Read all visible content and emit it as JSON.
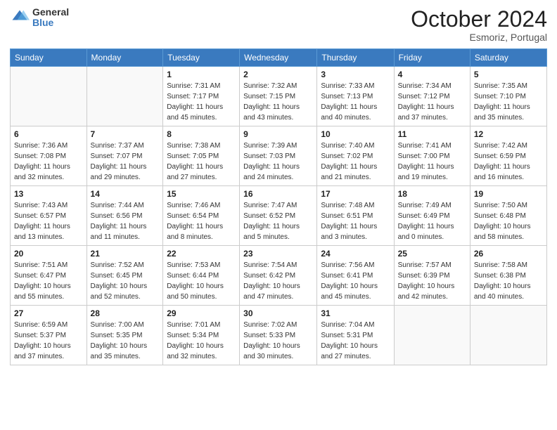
{
  "logo": {
    "general": "General",
    "blue": "Blue"
  },
  "header": {
    "month": "October 2024",
    "location": "Esmoriz, Portugal"
  },
  "weekdays": [
    "Sunday",
    "Monday",
    "Tuesday",
    "Wednesday",
    "Thursday",
    "Friday",
    "Saturday"
  ],
  "weeks": [
    [
      {
        "day": "",
        "sunrise": "",
        "sunset": "",
        "daylight": ""
      },
      {
        "day": "",
        "sunrise": "",
        "sunset": "",
        "daylight": ""
      },
      {
        "day": "1",
        "sunrise": "Sunrise: 7:31 AM",
        "sunset": "Sunset: 7:17 PM",
        "daylight": "Daylight: 11 hours and 45 minutes."
      },
      {
        "day": "2",
        "sunrise": "Sunrise: 7:32 AM",
        "sunset": "Sunset: 7:15 PM",
        "daylight": "Daylight: 11 hours and 43 minutes."
      },
      {
        "day": "3",
        "sunrise": "Sunrise: 7:33 AM",
        "sunset": "Sunset: 7:13 PM",
        "daylight": "Daylight: 11 hours and 40 minutes."
      },
      {
        "day": "4",
        "sunrise": "Sunrise: 7:34 AM",
        "sunset": "Sunset: 7:12 PM",
        "daylight": "Daylight: 11 hours and 37 minutes."
      },
      {
        "day": "5",
        "sunrise": "Sunrise: 7:35 AM",
        "sunset": "Sunset: 7:10 PM",
        "daylight": "Daylight: 11 hours and 35 minutes."
      }
    ],
    [
      {
        "day": "6",
        "sunrise": "Sunrise: 7:36 AM",
        "sunset": "Sunset: 7:08 PM",
        "daylight": "Daylight: 11 hours and 32 minutes."
      },
      {
        "day": "7",
        "sunrise": "Sunrise: 7:37 AM",
        "sunset": "Sunset: 7:07 PM",
        "daylight": "Daylight: 11 hours and 29 minutes."
      },
      {
        "day": "8",
        "sunrise": "Sunrise: 7:38 AM",
        "sunset": "Sunset: 7:05 PM",
        "daylight": "Daylight: 11 hours and 27 minutes."
      },
      {
        "day": "9",
        "sunrise": "Sunrise: 7:39 AM",
        "sunset": "Sunset: 7:03 PM",
        "daylight": "Daylight: 11 hours and 24 minutes."
      },
      {
        "day": "10",
        "sunrise": "Sunrise: 7:40 AM",
        "sunset": "Sunset: 7:02 PM",
        "daylight": "Daylight: 11 hours and 21 minutes."
      },
      {
        "day": "11",
        "sunrise": "Sunrise: 7:41 AM",
        "sunset": "Sunset: 7:00 PM",
        "daylight": "Daylight: 11 hours and 19 minutes."
      },
      {
        "day": "12",
        "sunrise": "Sunrise: 7:42 AM",
        "sunset": "Sunset: 6:59 PM",
        "daylight": "Daylight: 11 hours and 16 minutes."
      }
    ],
    [
      {
        "day": "13",
        "sunrise": "Sunrise: 7:43 AM",
        "sunset": "Sunset: 6:57 PM",
        "daylight": "Daylight: 11 hours and 13 minutes."
      },
      {
        "day": "14",
        "sunrise": "Sunrise: 7:44 AM",
        "sunset": "Sunset: 6:56 PM",
        "daylight": "Daylight: 11 hours and 11 minutes."
      },
      {
        "day": "15",
        "sunrise": "Sunrise: 7:46 AM",
        "sunset": "Sunset: 6:54 PM",
        "daylight": "Daylight: 11 hours and 8 minutes."
      },
      {
        "day": "16",
        "sunrise": "Sunrise: 7:47 AM",
        "sunset": "Sunset: 6:52 PM",
        "daylight": "Daylight: 11 hours and 5 minutes."
      },
      {
        "day": "17",
        "sunrise": "Sunrise: 7:48 AM",
        "sunset": "Sunset: 6:51 PM",
        "daylight": "Daylight: 11 hours and 3 minutes."
      },
      {
        "day": "18",
        "sunrise": "Sunrise: 7:49 AM",
        "sunset": "Sunset: 6:49 PM",
        "daylight": "Daylight: 11 hours and 0 minutes."
      },
      {
        "day": "19",
        "sunrise": "Sunrise: 7:50 AM",
        "sunset": "Sunset: 6:48 PM",
        "daylight": "Daylight: 10 hours and 58 minutes."
      }
    ],
    [
      {
        "day": "20",
        "sunrise": "Sunrise: 7:51 AM",
        "sunset": "Sunset: 6:47 PM",
        "daylight": "Daylight: 10 hours and 55 minutes."
      },
      {
        "day": "21",
        "sunrise": "Sunrise: 7:52 AM",
        "sunset": "Sunset: 6:45 PM",
        "daylight": "Daylight: 10 hours and 52 minutes."
      },
      {
        "day": "22",
        "sunrise": "Sunrise: 7:53 AM",
        "sunset": "Sunset: 6:44 PM",
        "daylight": "Daylight: 10 hours and 50 minutes."
      },
      {
        "day": "23",
        "sunrise": "Sunrise: 7:54 AM",
        "sunset": "Sunset: 6:42 PM",
        "daylight": "Daylight: 10 hours and 47 minutes."
      },
      {
        "day": "24",
        "sunrise": "Sunrise: 7:56 AM",
        "sunset": "Sunset: 6:41 PM",
        "daylight": "Daylight: 10 hours and 45 minutes."
      },
      {
        "day": "25",
        "sunrise": "Sunrise: 7:57 AM",
        "sunset": "Sunset: 6:39 PM",
        "daylight": "Daylight: 10 hours and 42 minutes."
      },
      {
        "day": "26",
        "sunrise": "Sunrise: 7:58 AM",
        "sunset": "Sunset: 6:38 PM",
        "daylight": "Daylight: 10 hours and 40 minutes."
      }
    ],
    [
      {
        "day": "27",
        "sunrise": "Sunrise: 6:59 AM",
        "sunset": "Sunset: 5:37 PM",
        "daylight": "Daylight: 10 hours and 37 minutes."
      },
      {
        "day": "28",
        "sunrise": "Sunrise: 7:00 AM",
        "sunset": "Sunset: 5:35 PM",
        "daylight": "Daylight: 10 hours and 35 minutes."
      },
      {
        "day": "29",
        "sunrise": "Sunrise: 7:01 AM",
        "sunset": "Sunset: 5:34 PM",
        "daylight": "Daylight: 10 hours and 32 minutes."
      },
      {
        "day": "30",
        "sunrise": "Sunrise: 7:02 AM",
        "sunset": "Sunset: 5:33 PM",
        "daylight": "Daylight: 10 hours and 30 minutes."
      },
      {
        "day": "31",
        "sunrise": "Sunrise: 7:04 AM",
        "sunset": "Sunset: 5:31 PM",
        "daylight": "Daylight: 10 hours and 27 minutes."
      },
      {
        "day": "",
        "sunrise": "",
        "sunset": "",
        "daylight": ""
      },
      {
        "day": "",
        "sunrise": "",
        "sunset": "",
        "daylight": ""
      }
    ]
  ]
}
